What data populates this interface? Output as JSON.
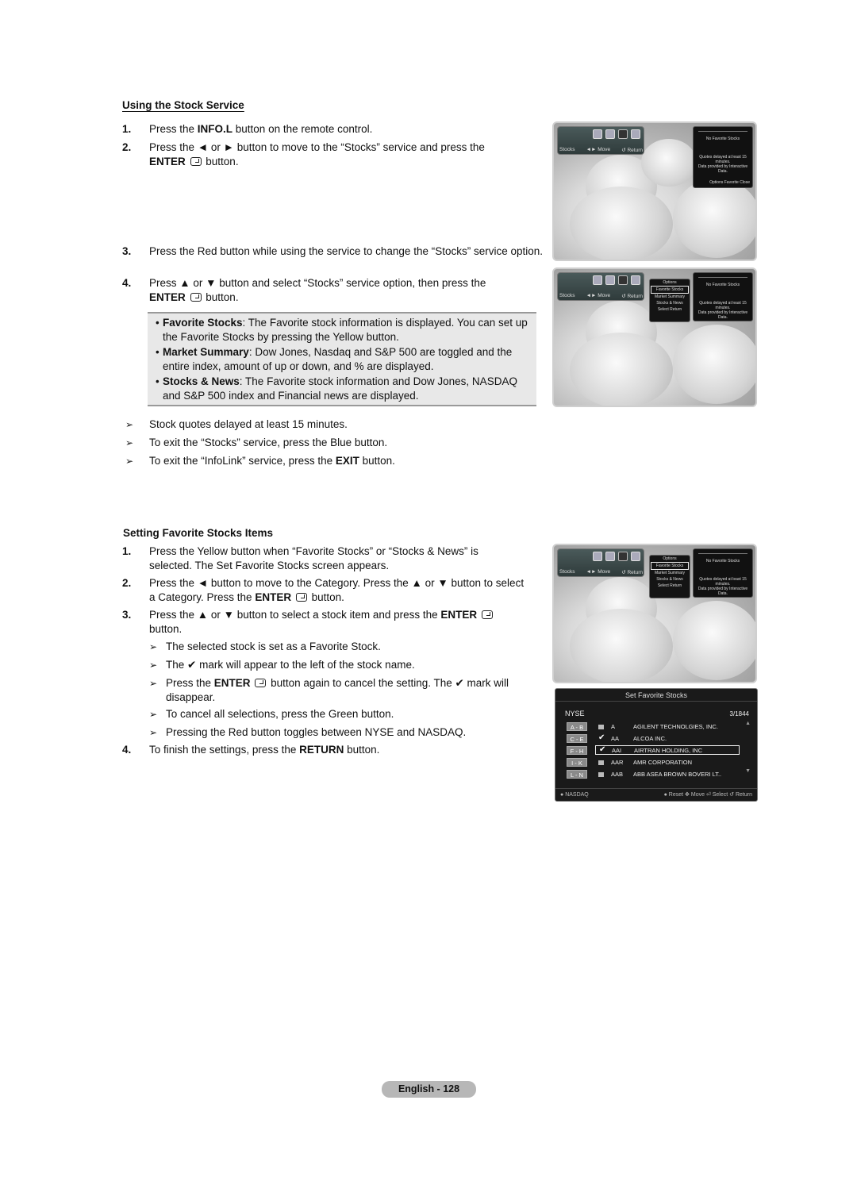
{
  "section1": {
    "title": "Using the Stock Service",
    "steps": [
      {
        "num": "1.",
        "pre": "Press the ",
        "bold": "INFO.L",
        "post": " button on the remote control."
      },
      {
        "num": "2.",
        "line1": "Press the ◄ or ► button to move to the “Stocks” service and press the",
        "bold": "ENTER",
        "post": " button."
      },
      {
        "num": "3.",
        "text": "Press the Red button while using the service to change the “Stocks” service option."
      },
      {
        "num": "4.",
        "line1": "Press ▲ or ▼ button and select “Stocks” service option, then press the",
        "bold": "ENTER",
        "post": " button."
      }
    ],
    "bullets": [
      {
        "term": "Favorite Stocks",
        "text": ": The Favorite stock information is displayed. You can set up the Favorite Stocks by pressing the Yellow button."
      },
      {
        "term": "Market Summary",
        "text": ": Dow Jones, Nasdaq and S&P 500 are toggled and the entire index, amount of up or down, and % are displayed."
      },
      {
        "term": "Stocks & News",
        "text": ": The Favorite stock information and Dow Jones, NASDAQ and S&P 500 index and Financial news are displayed."
      }
    ],
    "notes": [
      {
        "text": "Stock quotes delayed at least 15 minutes."
      },
      {
        "text": "To exit the “Stocks” service, press the Blue button."
      },
      {
        "pre": "To exit the “InfoLink” service, press the ",
        "bold": "EXIT",
        "post": " button."
      }
    ]
  },
  "section2": {
    "title": "Setting Favorite Stocks Items",
    "steps": [
      {
        "num": "1.",
        "text": "Press the Yellow button when “Favorite Stocks” or “Stocks & News” is selected. The Set Favorite Stocks screen appears."
      },
      {
        "num": "2.",
        "pre": "Press the ◄ button to move to the Category. Press the ▲ or ▼ button to select a Category. Press the ",
        "bold": "ENTER",
        "post": " button."
      },
      {
        "num": "3.",
        "pre": "Press the ▲ or ▼ button to select a stock item and press the ",
        "bold": "ENTER",
        "post": " button."
      },
      {
        "num": "4.",
        "pre": "To finish the settings, press the ",
        "bold": "RETURN",
        "post": " button."
      }
    ],
    "notes": [
      {
        "text": "The selected stock is set as a Favorite Stock."
      },
      {
        "pre": "The ",
        "check": "✔",
        "post": " mark will appear to the left of the stock name."
      },
      {
        "pre": "Press the ",
        "bold": "ENTER",
        "mid": " button again to cancel the setting. The ",
        "check": "✔",
        "post": " mark will disappear."
      },
      {
        "text": "To cancel all selections, press the Green button."
      },
      {
        "text": "Pressing the Red button toggles between NYSE and NASDAQ."
      }
    ]
  },
  "tv": {
    "service_label": "Stocks",
    "move_label": "◄► Move",
    "return_label": "↺ Return",
    "no_favorites": "No Favorite Stocks",
    "delay_note": "Quotes delayed at least 15 minutes.",
    "provider_note": "Data provided by Interactive Data.",
    "footer": {
      "options": "Options",
      "favorite": "Favorite",
      "close": "Close"
    },
    "options_menu": {
      "title": "Options",
      "items": [
        "Favorite Stocks",
        "Market Summary",
        "Stocks & News"
      ],
      "selected": "Favorite Stocks",
      "select_label": "Select",
      "return_label": "Return"
    }
  },
  "set_favorite": {
    "title": "Set Favorite Stocks",
    "market": "NYSE",
    "count": "3/1844",
    "categories": [
      "A - B",
      "C - E",
      "F - H",
      "I - K",
      "L - N"
    ],
    "stocks": [
      {
        "symbol": "A",
        "name": "AGILENT TECHNOLGIES, INC.",
        "checked": false
      },
      {
        "symbol": "AA",
        "name": "ALCOA INC.",
        "checked": true
      },
      {
        "symbol": "AAI",
        "name": "AIRTRAN HOLDING, INC",
        "checked": true,
        "selected": true
      },
      {
        "symbol": "AAR",
        "name": "AMR CORPORATION",
        "checked": false
      },
      {
        "symbol": "AAB",
        "name": "ABB ASEA BROWN BOVERI LT..",
        "checked": false
      }
    ],
    "footer": {
      "toggle": "NASDAQ",
      "reset": "Reset",
      "move": "Move",
      "select": "Select",
      "return": "Return"
    }
  },
  "page_label": "English - 128"
}
